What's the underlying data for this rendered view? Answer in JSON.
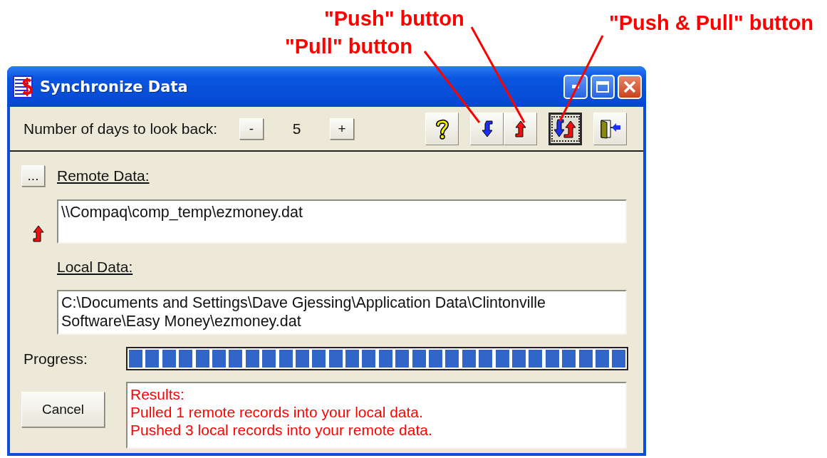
{
  "annotations": [
    {
      "kind": "push",
      "text": "\"Push\" button"
    },
    {
      "kind": "pull",
      "text": "\"Pull\" button"
    },
    {
      "kind": "pushpull",
      "text": "\"Push & Pull\" button"
    }
  ],
  "window": {
    "title": "Synchronize Data"
  },
  "toolbar": {
    "days_label": "Number of days to look back:",
    "decrement": "-",
    "days": "5",
    "increment": "+",
    "buttons": [
      {
        "kind": "help",
        "focused": false
      },
      {
        "kind": "pull",
        "focused": false
      },
      {
        "kind": "push",
        "focused": false
      },
      {
        "kind": "pushpull",
        "focused": true
      },
      {
        "kind": "exit",
        "focused": false
      }
    ]
  },
  "browse_button": "...",
  "remote": {
    "label": "Remote Data:",
    "value": "\\\\Compaq\\comp_temp\\ezmoney.dat"
  },
  "direction_icon": {
    "kind": "push"
  },
  "local": {
    "label": "Local Data:",
    "value": "C:\\Documents and Settings\\Dave Gjessing\\Application Data\\Clintonville Software\\Easy Money\\ezmoney.dat"
  },
  "progress": {
    "label": "Progress:",
    "level": 1
  },
  "cancel_button": "Cancel",
  "results": [
    "Results:",
    "Pulled 1 remote records into your local data.",
    "Pushed 3 local records into your remote data."
  ]
}
